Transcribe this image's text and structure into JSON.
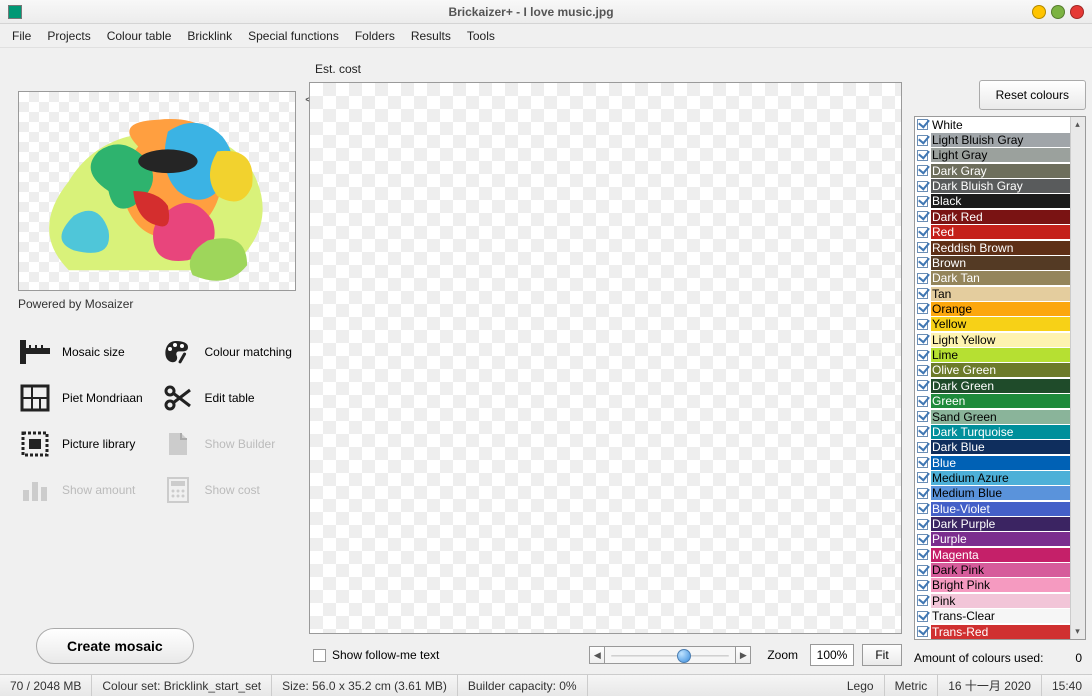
{
  "title": "Brickaizer+  - I love music.jpg",
  "menu": [
    "File",
    "Projects",
    "Colour table",
    "Bricklink",
    "Special functions",
    "Folders",
    "Results",
    "Tools"
  ],
  "powered": "Powered by Mosaizer",
  "estCost": "Est. cost",
  "tools": {
    "mosaicSize": "Mosaic size",
    "colourMatching": "Colour matching",
    "pietMondriaan": "Piet Mondriaan",
    "editTable": "Edit table",
    "pictureLibrary": "Picture library",
    "showBuilder": "Show Builder",
    "showAmount": "Show amount",
    "showCost": "Show cost"
  },
  "createBtn": "Create mosaic",
  "followMe": "Show follow-me text",
  "zoomLabel": "Zoom",
  "zoomValue": "100%",
  "fitLabel": "Fit",
  "resetBtn": "Reset colours",
  "amountLabel": "Amount of colours used:",
  "amountValue": "0",
  "status": {
    "mem": "70 / 2048 MB",
    "colourSet": "Colour set: Bricklink_start_set",
    "size": "Size: 56.0 x 35.2 cm (3.61 MB)",
    "builderCap": "Builder capacity: 0%",
    "system": "Lego",
    "units": "Metric",
    "date": "16 十一月 2020",
    "time": "15:40"
  },
  "colours": [
    {
      "name": "White",
      "bg": "#ffffff",
      "dark": false
    },
    {
      "name": "Light Bluish Gray",
      "bg": "#a0a5a9",
      "dark": false
    },
    {
      "name": "Light Gray",
      "bg": "#9ba19d",
      "dark": false
    },
    {
      "name": "Dark Gray",
      "bg": "#6d6e5c",
      "dark": true
    },
    {
      "name": "Dark Bluish Gray",
      "bg": "#595b5c",
      "dark": true
    },
    {
      "name": "Black",
      "bg": "#1b1b1b",
      "dark": true
    },
    {
      "name": "Dark Red",
      "bg": "#7a1313",
      "dark": true
    },
    {
      "name": "Red",
      "bg": "#c4201a",
      "dark": true
    },
    {
      "name": "Reddish Brown",
      "bg": "#5e2f16",
      "dark": true
    },
    {
      "name": "Brown",
      "bg": "#543a24",
      "dark": true
    },
    {
      "name": "Dark Tan",
      "bg": "#94855b",
      "dark": true
    },
    {
      "name": "Tan",
      "bg": "#e4cd9e",
      "dark": false
    },
    {
      "name": "Orange",
      "bg": "#fca70d",
      "dark": false
    },
    {
      "name": "Yellow",
      "bg": "#f7d117",
      "dark": false
    },
    {
      "name": "Light Yellow",
      "bg": "#fef3b0",
      "dark": false
    },
    {
      "name": "Lime",
      "bg": "#b6e032",
      "dark": false
    },
    {
      "name": "Olive Green",
      "bg": "#6c7b2a",
      "dark": true
    },
    {
      "name": "Dark Green",
      "bg": "#1f4b2a",
      "dark": true
    },
    {
      "name": "Green",
      "bg": "#1e8a3b",
      "dark": true
    },
    {
      "name": "Sand Green",
      "bg": "#8ab49a",
      "dark": false
    },
    {
      "name": "Dark Turquoise",
      "bg": "#008f9b",
      "dark": true
    },
    {
      "name": "Dark Blue",
      "bg": "#0f2e5d",
      "dark": true
    },
    {
      "name": "Blue",
      "bg": "#0061b5",
      "dark": true
    },
    {
      "name": "Medium Azure",
      "bg": "#4db0d8",
      "dark": false
    },
    {
      "name": "Medium Blue",
      "bg": "#5a93db",
      "dark": false
    },
    {
      "name": "Blue-Violet",
      "bg": "#4460c8",
      "dark": true
    },
    {
      "name": "Dark Purple",
      "bg": "#3b2462",
      "dark": true
    },
    {
      "name": "Purple",
      "bg": "#7b2e8e",
      "dark": true
    },
    {
      "name": "Magenta",
      "bg": "#c52069",
      "dark": true
    },
    {
      "name": "Dark Pink",
      "bg": "#d65c9b",
      "dark": false
    },
    {
      "name": "Bright Pink",
      "bg": "#f59ac0",
      "dark": false
    },
    {
      "name": "Pink",
      "bg": "#f2c5d8",
      "dark": false
    },
    {
      "name": "Trans-Clear",
      "bg": "#f6f6f6",
      "dark": false
    },
    {
      "name": "Trans-Red",
      "bg": "#d03030",
      "dark": true
    }
  ]
}
